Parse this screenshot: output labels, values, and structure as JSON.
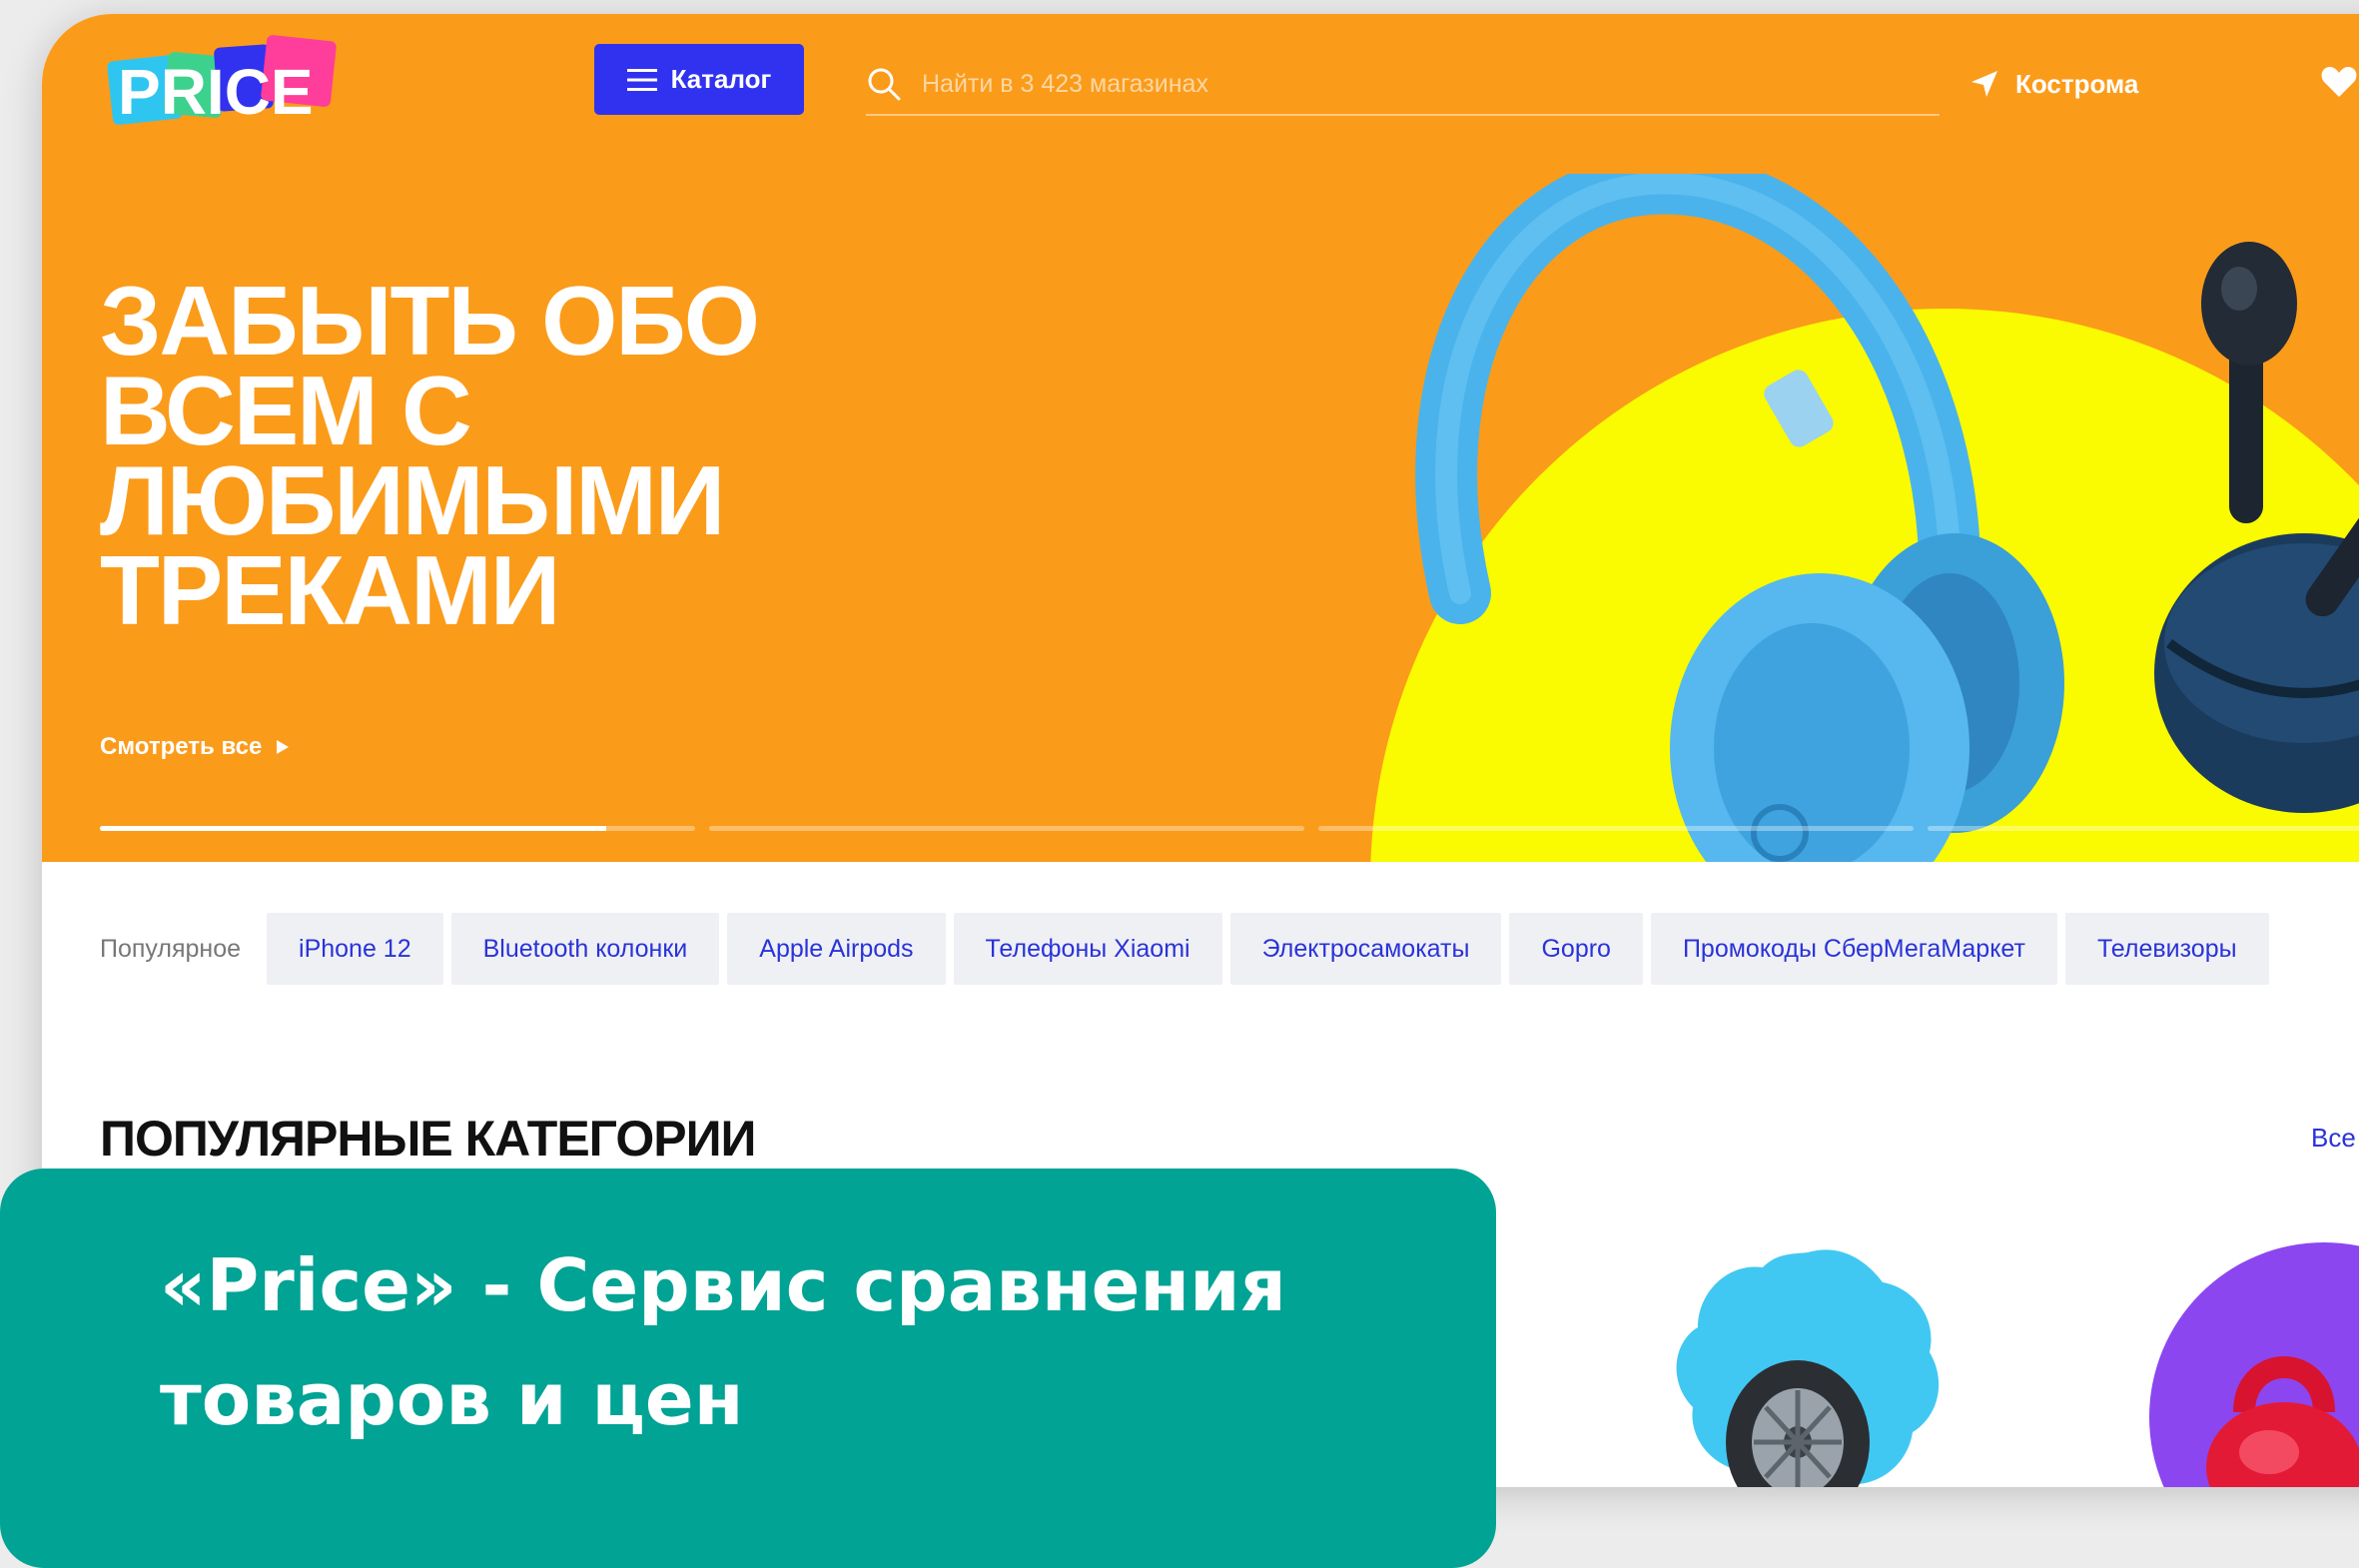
{
  "header": {
    "logo_text": "PRICE",
    "catalog_label": "Каталог",
    "search_placeholder": "Найти в 3 423 магазинах",
    "city": "Кострома"
  },
  "promo": {
    "title_lines": [
      "ЗАБЫТЬ ОБО",
      "ВСЕМ С",
      "ЛЮБИМЫМИ",
      "ТРЕКАМИ"
    ],
    "see_all_label": "Смотреть все",
    "slides_count": 4,
    "active_slide": 1,
    "active_slide_progress": 0.85
  },
  "popular": {
    "label": "Популярное",
    "tags": [
      "iPhone 12",
      "Bluetooth колонки",
      "Apple Airpods",
      "Телефоны Xiaomi",
      "Электросамокаты",
      "Gopro",
      "Промокоды СберМегаМаркет",
      "Телевизоры"
    ]
  },
  "categories": {
    "title": "ПОПУЛЯРНЫЕ КАТЕГОРИИ",
    "all_link": "Все"
  },
  "overlay": {
    "caption": "«Price» - Сервис сравнения товаров и цен"
  },
  "colors": {
    "hero_orange": "#fb9b1a",
    "sun_yellow": "#fafa00",
    "catalog_blue": "#3132f0",
    "tag_text_blue": "#2a33d8",
    "overlay_teal": "#00a394"
  },
  "icons": [
    "menu-icon",
    "search-icon",
    "location-arrow-icon",
    "heart-icon",
    "play-arrow-icon"
  ]
}
